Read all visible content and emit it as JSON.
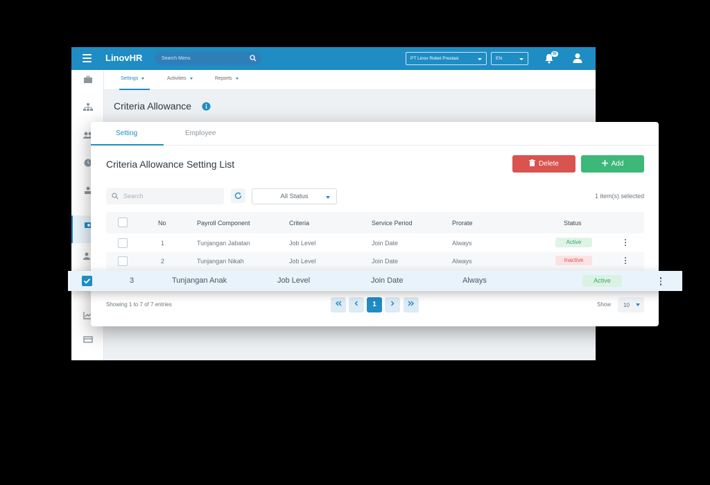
{
  "app": {
    "brand": "LinovHR",
    "search_placeholder": "Search Menu",
    "company": "PT Linov Roket Prestasi",
    "language": "EN",
    "notification_count": "99"
  },
  "subnav": {
    "tabs": [
      {
        "label": "Settings"
      },
      {
        "label": "Activities"
      },
      {
        "label": "Reports"
      }
    ]
  },
  "page": {
    "title": "Criteria Allowance"
  },
  "card": {
    "tabs": [
      {
        "label": "Setting"
      },
      {
        "label": "Employee"
      }
    ],
    "list_title": "Criteria Allowance Setting List",
    "delete_label": "Delete",
    "add_label": "Add",
    "search_placeholder": "Search",
    "status_filter": "All Status",
    "selected_text": "1 item(s) selected"
  },
  "table": {
    "headers": {
      "no": "No",
      "payroll_component": "Payroll Component",
      "criteria": "Criteria",
      "service_period": "Service Period",
      "prorate": "Prorate",
      "status": "Status"
    },
    "rows": [
      {
        "no": "1",
        "payroll_component": "Tunjangan Jabatan",
        "criteria": "Job Level",
        "service_period": "Join Date",
        "prorate": "Always",
        "status": "Active"
      },
      {
        "no": "2",
        "payroll_component": "Tunjangan Nikah",
        "criteria": "Job Level",
        "service_period": "Join Date",
        "prorate": "Always",
        "status": "Inactive"
      },
      {
        "no": "3",
        "payroll_component": "Tunjangan Anak",
        "criteria": "Job Level",
        "service_period": "Join Date",
        "prorate": "Always",
        "status": "Active"
      }
    ]
  },
  "footer": {
    "entries_text": "Showing 1 to 7 of 7 entries",
    "current_page": "1",
    "show_label": "Show",
    "page_size": "10"
  },
  "colors": {
    "primary": "#1f8cc4",
    "delete": "#d9534f",
    "add": "#3cb878",
    "active": "#34a864",
    "inactive": "#e24b4b"
  },
  "icons": [
    "hamburger-icon",
    "search-icon",
    "bell-icon",
    "user-icon",
    "info-icon",
    "trash-icon",
    "plus-icon",
    "refresh-icon",
    "chevron-down-icon",
    "kebab-icon",
    "double-chevron-left-icon",
    "chevron-left-icon",
    "chevron-right-icon",
    "double-chevron-right-icon",
    "check-icon"
  ]
}
